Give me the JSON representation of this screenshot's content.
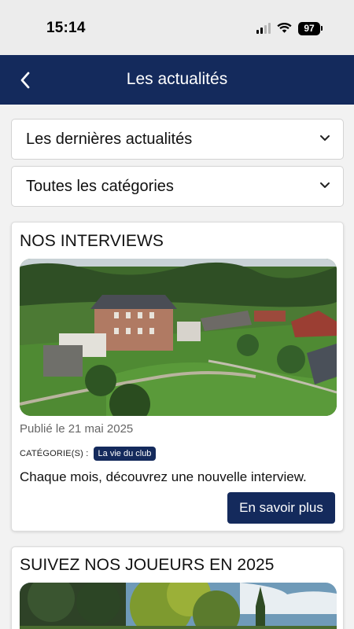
{
  "status_bar": {
    "time": "15:14",
    "battery": "97"
  },
  "header": {
    "title": "Les actualités"
  },
  "filters": {
    "sort_label": "Les dernières actualités",
    "category_label": "Toutes les catégories"
  },
  "articles": [
    {
      "title": "NOS INTERVIEWS",
      "date": "Publié le 21 mai 2025",
      "category_prefix": "CATÉGORIE(S) :",
      "category": "La vie du club",
      "description": "Chaque mois, découvrez une nouvelle interview.",
      "button_label": "En savoir plus"
    },
    {
      "title": "SUIVEZ NOS JOUEURS EN 2025"
    }
  ],
  "colors": {
    "brand": "#142a5c",
    "status_bar": "#ececec",
    "page_bg": "#f2f2f2"
  }
}
